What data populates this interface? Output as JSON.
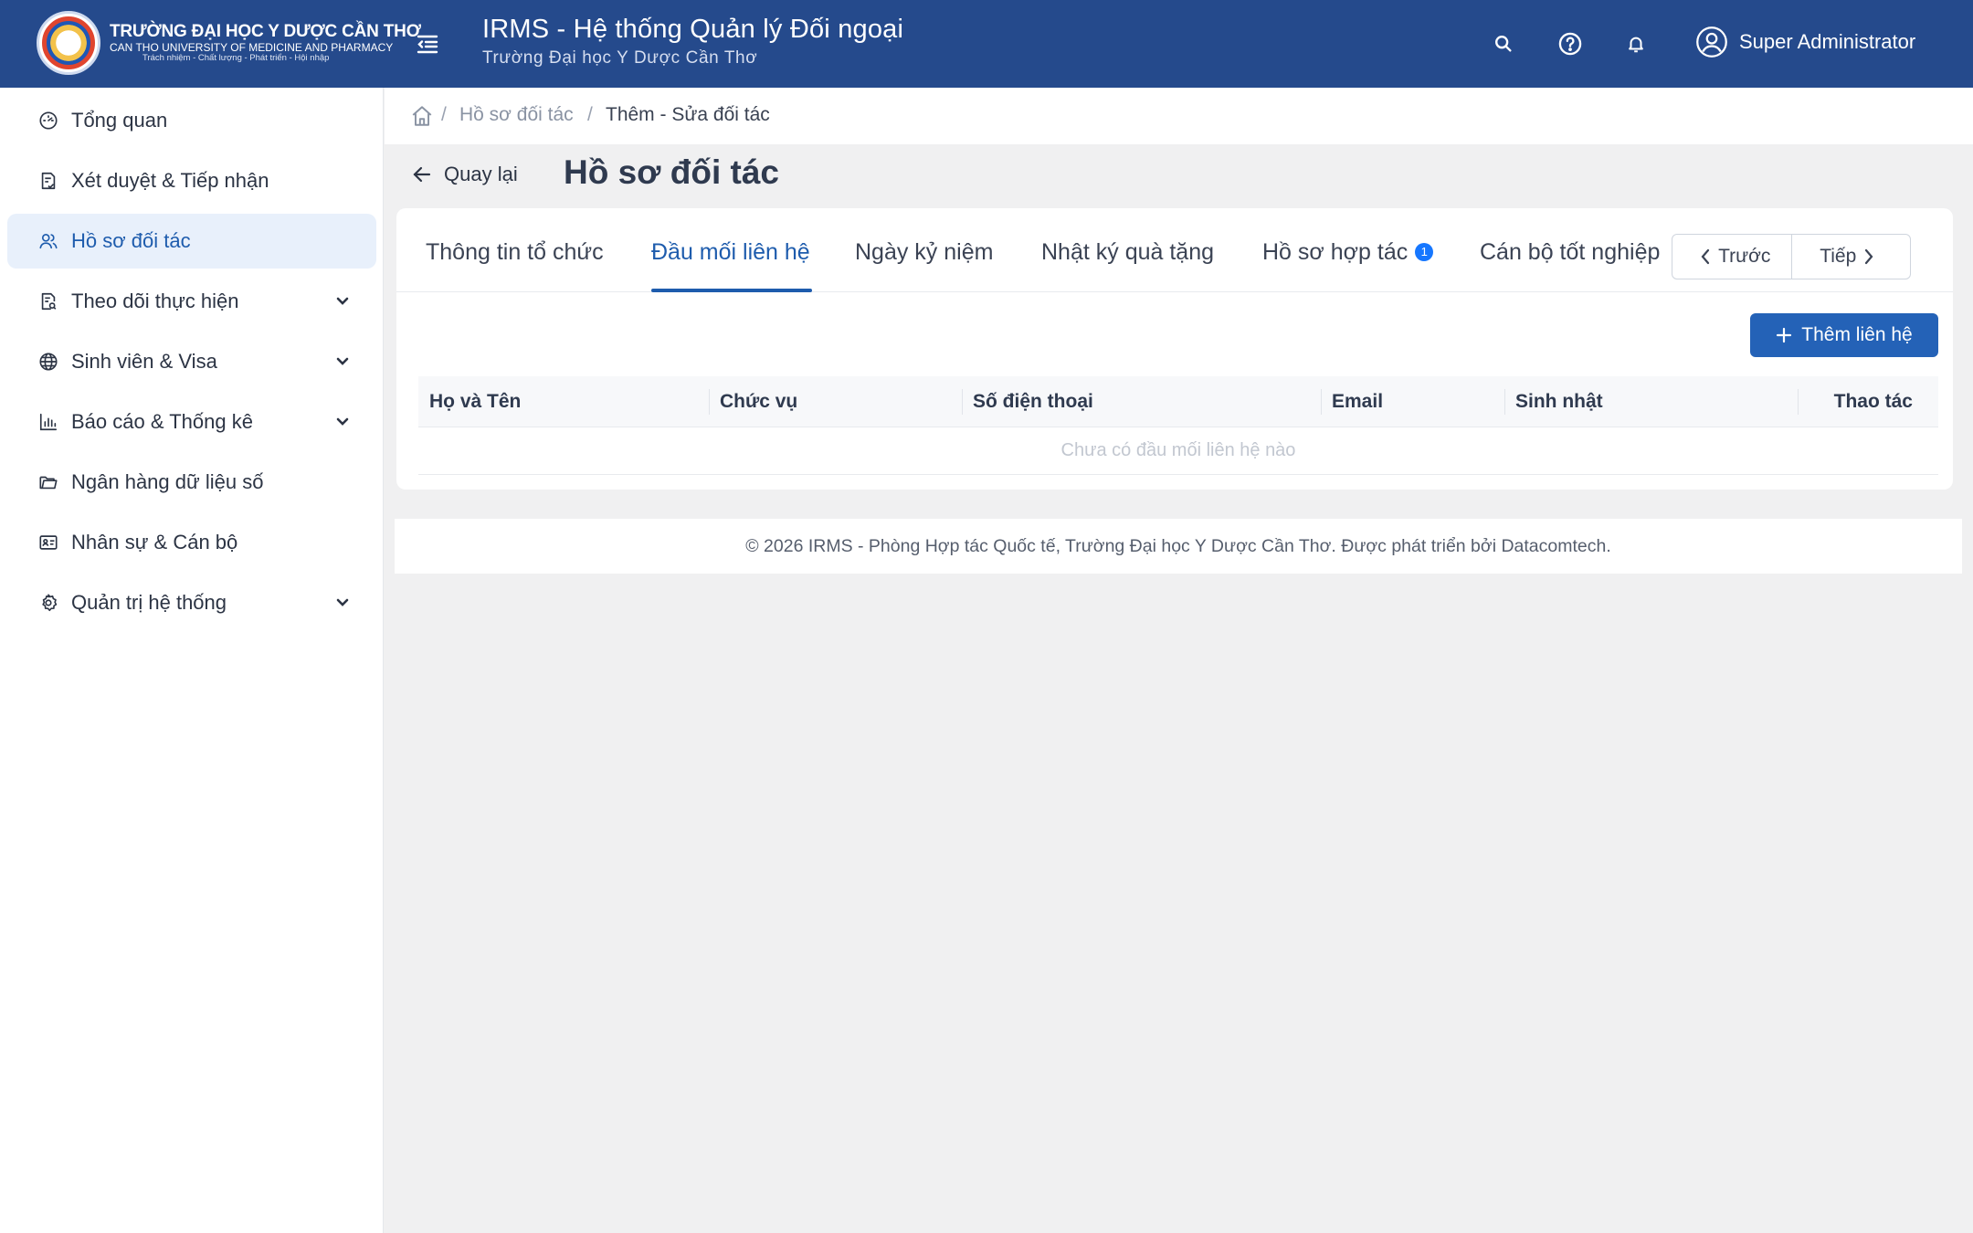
{
  "header": {
    "logo": {
      "line1": "TRƯỜNG ĐẠI HỌC Y DƯỢC CẦN THƠ",
      "line2": "CAN THO UNIVERSITY OF MEDICINE AND PHARMACY",
      "line3": "Trách nhiệm - Chất lượng - Phát triển - Hội nhập"
    },
    "title": "IRMS - Hệ thống Quản lý Đối ngoại",
    "subtitle": "Trường Đại học Y Dược Cần Thơ",
    "icons": [
      "search-icon",
      "help-icon",
      "bell-icon",
      "user-circle-icon"
    ],
    "user_name": "Super Administrator"
  },
  "sidebar": {
    "items": [
      {
        "label": "Tổng quan",
        "icon": "dashboard-icon",
        "expandable": false,
        "active": false
      },
      {
        "label": "Xét duyệt & Tiếp nhận",
        "icon": "document-check-icon",
        "expandable": false,
        "active": false
      },
      {
        "label": "Hồ sơ đối tác",
        "icon": "users-icon",
        "expandable": false,
        "active": true
      },
      {
        "label": "Theo dõi thực hiện",
        "icon": "document-search-icon",
        "expandable": true,
        "active": false
      },
      {
        "label": "Sinh viên & Visa",
        "icon": "globe-icon",
        "expandable": true,
        "active": false
      },
      {
        "label": "Báo cáo & Thống kê",
        "icon": "bar-chart-icon",
        "expandable": true,
        "active": false
      },
      {
        "label": "Ngân hàng dữ liệu số",
        "icon": "folder-icon",
        "expandable": false,
        "active": false
      },
      {
        "label": "Nhân sự & Cán bộ",
        "icon": "id-card-icon",
        "expandable": false,
        "active": false
      },
      {
        "label": "Quản trị hệ thống",
        "icon": "gear-icon",
        "expandable": true,
        "active": false
      }
    ]
  },
  "breadcrumb": {
    "items": [
      "Hồ sơ đối tác",
      "Thêm - Sửa đối tác"
    ],
    "separator": "/"
  },
  "page": {
    "back_label": "Quay lại",
    "title": "Hồ sơ đối tác"
  },
  "tabs": {
    "items": [
      {
        "label": "Thông tin tổ chức",
        "active": false
      },
      {
        "label": "Đầu mối liên hệ",
        "active": true
      },
      {
        "label": "Ngày kỷ niệm",
        "active": false
      },
      {
        "label": "Nhật ký quà tặng",
        "active": false
      },
      {
        "label": "Hồ sơ hợp tác",
        "active": false,
        "badge": "1"
      },
      {
        "label": "Cán bộ tốt nghiệp",
        "active": false
      }
    ],
    "prev_label": "Trước",
    "next_label": "Tiếp"
  },
  "contacts": {
    "add_label": "Thêm liên hệ",
    "columns": [
      "Họ và Tên",
      "Chức vụ",
      "Số điện thoại",
      "Email",
      "Sinh nhật",
      "Thao tác"
    ],
    "rows": [],
    "empty_text": "Chưa có đầu mối liên hệ nào"
  },
  "footer": {
    "text": "© 2026 IRMS - Phòng Hợp tác Quốc tế, Trường Đại học Y Dược Cần Thơ. Được phát triển bởi Datacomtech."
  },
  "colors": {
    "header_bg": "#254a8c",
    "accent": "#1e5cad",
    "primary_button": "#2462b7",
    "badge": "#1677ff",
    "page_bg": "#f0f0f1"
  }
}
